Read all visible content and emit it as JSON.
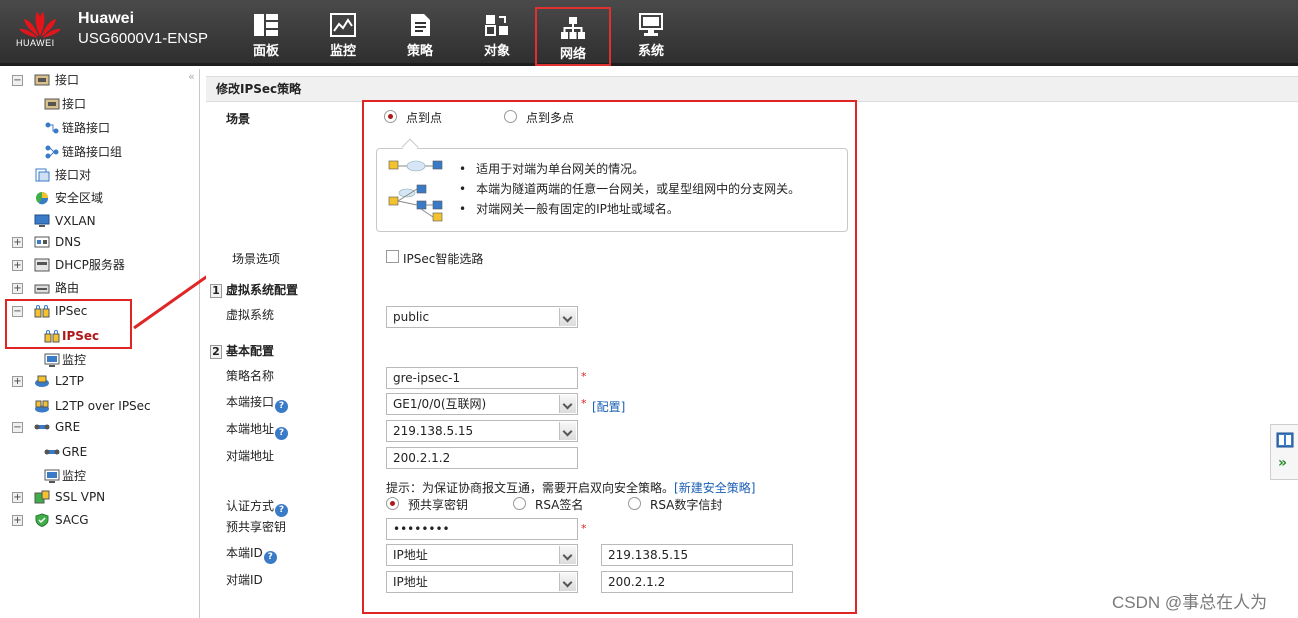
{
  "header": {
    "logo_text": "HUAWEI",
    "brand_name": "Huawei",
    "model": "USG6000V1-ENSP",
    "nav": [
      {
        "label": "面板",
        "icon": "dashboard-icon"
      },
      {
        "label": "监控",
        "icon": "monitor-chart-icon"
      },
      {
        "label": "策略",
        "icon": "policy-document-icon"
      },
      {
        "label": "对象",
        "icon": "object-icon"
      },
      {
        "label": "网络",
        "icon": "network-topology-icon",
        "active": true
      },
      {
        "label": "系统",
        "icon": "system-computer-icon"
      }
    ]
  },
  "tree": {
    "collapse_glyph": "«",
    "items": [
      {
        "label": "接口",
        "icon": "interface-icon",
        "expander": "−"
      },
      {
        "label": "接口",
        "icon": "interface-icon"
      },
      {
        "label": "链路接口",
        "icon": "link-icon"
      },
      {
        "label": "链路接口组",
        "icon": "link-group-icon"
      },
      {
        "label": "接口对",
        "icon": "interface-pair-icon"
      },
      {
        "label": "安全区域",
        "icon": "security-zone-icon"
      },
      {
        "label": "VXLAN",
        "icon": "vxlan-icon"
      },
      {
        "label": "DNS",
        "icon": "dns-icon",
        "expander": "+"
      },
      {
        "label": "DHCP服务器",
        "icon": "dhcp-icon",
        "expander": "+"
      },
      {
        "label": "路由",
        "icon": "route-icon",
        "expander": "+"
      },
      {
        "label": "IPSec",
        "icon": "ipsec-icon",
        "expander": "−"
      },
      {
        "label": "IPSec",
        "icon": "ipsec-icon",
        "selected": true
      },
      {
        "label": "监控",
        "icon": "monitor-icon"
      },
      {
        "label": "L2TP",
        "icon": "l2tp-icon",
        "expander": "+"
      },
      {
        "label": "L2TP over IPSec",
        "icon": "l2tp-ipsec-icon"
      },
      {
        "label": "GRE",
        "icon": "gre-icon",
        "expander": "−"
      },
      {
        "label": "GRE",
        "icon": "gre-icon"
      },
      {
        "label": "监控",
        "icon": "monitor-icon"
      },
      {
        "label": "SSL VPN",
        "icon": "sslvpn-icon",
        "expander": "+"
      },
      {
        "label": "SACG",
        "icon": "sacg-icon",
        "expander": "+"
      }
    ]
  },
  "panel": {
    "title": "修改IPSec策略",
    "scene_label": "场景",
    "scene_options": [
      {
        "label": "点到点",
        "checked": true
      },
      {
        "label": "点到多点",
        "checked": false
      }
    ],
    "info_lines": [
      "适用于对端为单台网关的情况。",
      "本端为隧道两端的任意一台网关，或星型组网中的分支网关。",
      "对端网关一般有固定的IP地址或域名。"
    ],
    "scene_options_label": "场景选项",
    "smart_route_label": "IPSec智能选路",
    "section1_num": "1",
    "section1_title": "虚拟系统配置",
    "vsys_label": "虚拟系统",
    "vsys_value": "public",
    "section2_num": "2",
    "section2_title": "基本配置",
    "policy_name_label": "策略名称",
    "policy_name_value": "gre-ipsec-1",
    "local_if_label": "本端接口",
    "local_if_value": "GE1/0/0(互联网)",
    "config_link": "[配置]",
    "local_addr_label": "本端地址",
    "local_addr_value": "219.138.5.15",
    "peer_addr_label": "对端地址",
    "peer_addr_value": "200.2.1.2",
    "hint_text": "提示：为保证协商报文互通，需要开启双向安全策略。",
    "new_policy_link": "[新建安全策略]",
    "auth_label": "认证方式",
    "auth_options": [
      {
        "label": "预共享密钥",
        "checked": true
      },
      {
        "label": "RSA签名",
        "checked": false
      },
      {
        "label": "RSA数字信封",
        "checked": false
      }
    ],
    "psk_label": "预共享密钥",
    "psk_value": "••••••••",
    "local_id_label": "本端ID",
    "local_id_type": "IP地址",
    "local_id_value": "219.138.5.15",
    "peer_id_label": "对端ID",
    "peer_id_type": "IP地址",
    "peer_id_value": "200.2.1.2",
    "help_glyph": "?",
    "required_mark": "*"
  },
  "side_tools": {
    "expand_glyph": "»"
  },
  "watermark": "CSDN @事总在人为",
  "colors": {
    "accent_red": "#e02525",
    "header_bg": "#3a3a3a",
    "link": "#1b5fb5"
  }
}
